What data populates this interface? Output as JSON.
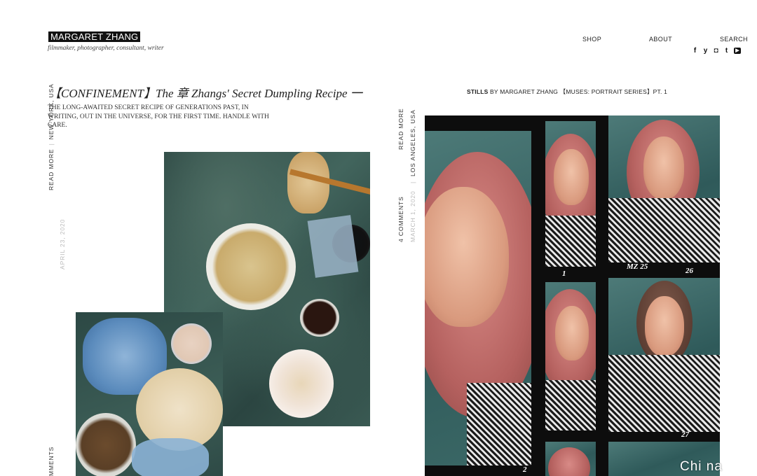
{
  "header": {
    "logo": "MARGARET ZHANG",
    "tagline": "filmmaker, photographer, consultant, writer",
    "nav": [
      "SHOP",
      "ABOUT",
      "SEARCH"
    ],
    "social_icons": [
      "facebook-icon",
      "twitter-icon",
      "instagram-icon",
      "tumblr-icon",
      "youtube-icon"
    ],
    "social_glyphs": [
      "f",
      "y",
      "◘",
      "t",
      "▶"
    ]
  },
  "left_post": {
    "title": "【CONFINEMENT】The 章 Zhangs' Secret Dumpling Recipe 一",
    "excerpt": "THE LONG-AWAITED SECRET RECIPE OF GENERATIONS PAST, IN WRITING, OUT IN THE UNIVERSE, FOR THE FIRST TIME. HANDLE WITH CARE.",
    "read_more": "READ MORE",
    "location": "NEW YORK, USA",
    "date": "APRIL 23, 2020",
    "comments": "MMENTS"
  },
  "right_post": {
    "label_bold": "STILLS",
    "label_rest": " BY MARGARET ZHANG 【MUSES: PORTRAIT SERIES】PT. 1",
    "read_more": "READ MORE",
    "location": "LOS ANGELES, USA",
    "comments": "4 COMMENTS",
    "date": "MARCH 1, 2020",
    "frame_marks": [
      "MZ 25",
      "26",
      "27",
      "1",
      "2"
    ]
  },
  "watermark": "Chi na",
  "colors": {
    "background": "#ffffff",
    "logo_bg": "#111111",
    "muted_text": "#bbbbbb",
    "marble_green": "#3a5a53"
  }
}
